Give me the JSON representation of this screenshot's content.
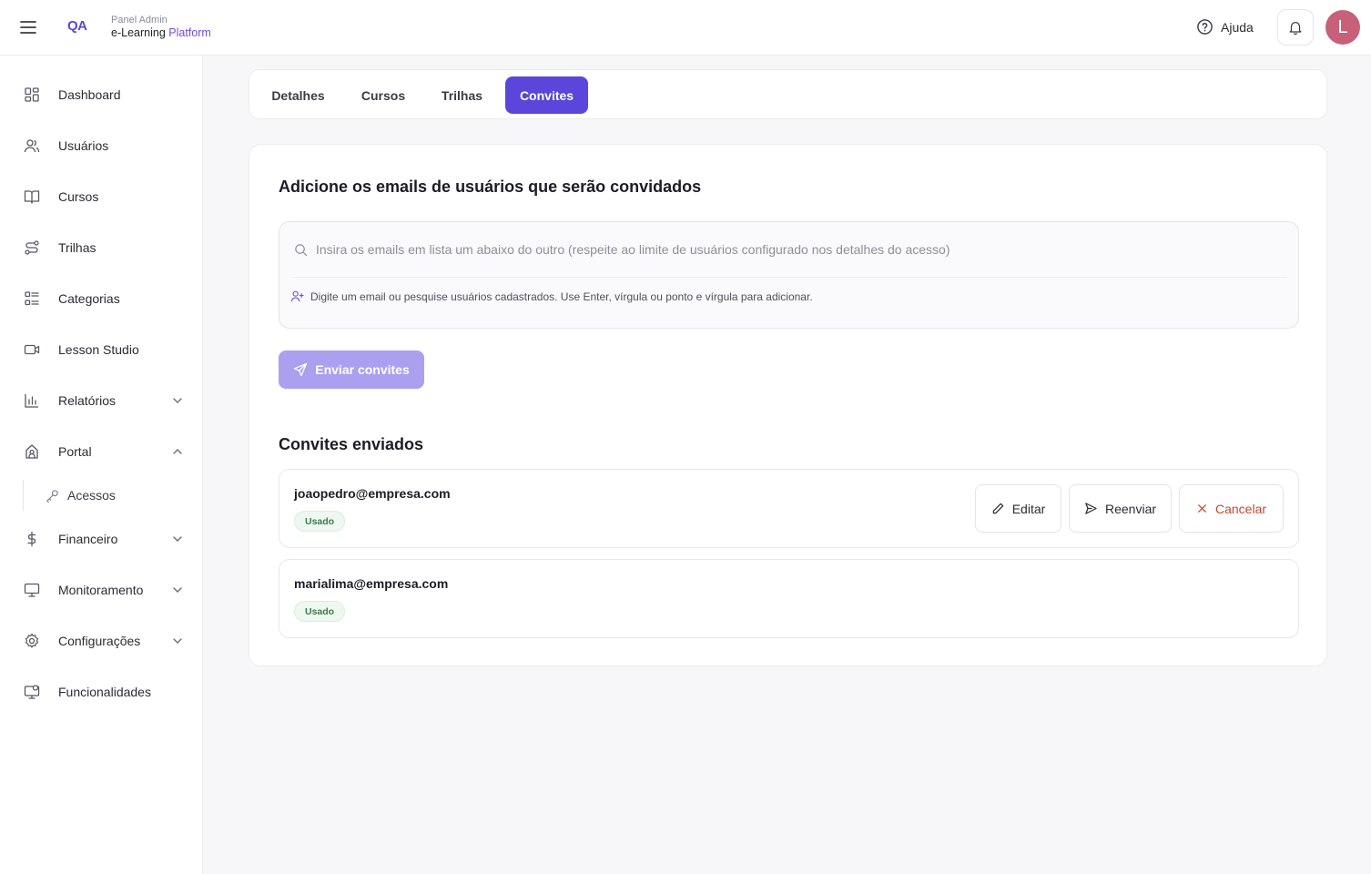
{
  "header": {
    "logo": "QA",
    "brand_sub": "Panel Admin",
    "brand_main": "e-Learning",
    "brand_accent": "Platform",
    "help_label": "Ajuda",
    "avatar_initial": "L"
  },
  "sidebar": {
    "items": [
      {
        "label": "Dashboard",
        "icon": "dashboard-icon"
      },
      {
        "label": "Usuários",
        "icon": "users-icon"
      },
      {
        "label": "Cursos",
        "icon": "book-icon"
      },
      {
        "label": "Trilhas",
        "icon": "route-icon"
      },
      {
        "label": "Categorias",
        "icon": "list-icon"
      },
      {
        "label": "Lesson Studio",
        "icon": "video-icon"
      },
      {
        "label": "Relatórios",
        "icon": "bar-chart-icon"
      },
      {
        "label": "Portal",
        "icon": "portal-icon"
      },
      {
        "label": "Financeiro",
        "icon": "dollar-icon"
      },
      {
        "label": "Monitoramento",
        "icon": "monitor-icon"
      },
      {
        "label": "Configurações",
        "icon": "gear-icon"
      },
      {
        "label": "Funcionalidades",
        "icon": "features-icon"
      }
    ],
    "sub_item": {
      "label": "Acessos",
      "icon": "key-icon"
    }
  },
  "tabs": [
    {
      "label": "Detalhes"
    },
    {
      "label": "Cursos"
    },
    {
      "label": "Trilhas"
    },
    {
      "label": "Convites",
      "active": true
    }
  ],
  "invite": {
    "heading": "Adicione os emails de usuários que serão convidados",
    "placeholder": "Insira os emails em lista um abaixo do outro (respeite ao limite de usuários configurado nos detalhes do acesso)",
    "hint": "Digite um email ou pesquise usuários cadastrados. Use Enter, vírgula ou ponto e vírgula para adicionar.",
    "send_label": "Enviar convites"
  },
  "sent": {
    "heading": "Convites enviados",
    "rows": [
      {
        "email": "joaopedro@empresa.com",
        "status": "Usado"
      },
      {
        "email": "marialima@empresa.com",
        "status": "Usado"
      }
    ],
    "actions": {
      "edit": "Editar",
      "resend": "Reenviar",
      "cancel": "Cancelar"
    }
  },
  "colors": {
    "accent": "#5a46db",
    "accent_disabled": "#ab9ff0",
    "danger": "#c4472f",
    "success": "#3d7a4c"
  }
}
